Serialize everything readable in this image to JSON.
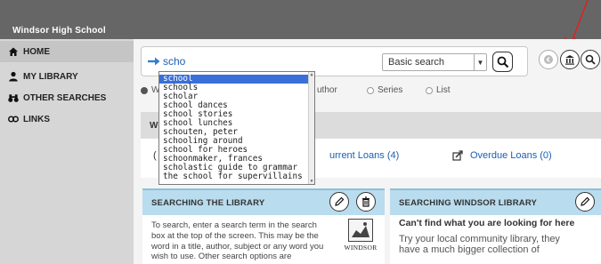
{
  "header": {
    "school_name": "Windsor High School"
  },
  "sidebar": {
    "items": [
      {
        "label": "HOME",
        "icon": "home-icon",
        "active": true
      },
      {
        "label": "MY LIBRARY",
        "icon": "person-icon",
        "active": false
      },
      {
        "label": "OTHER SEARCHES",
        "icon": "binoculars-icon",
        "active": false
      },
      {
        "label": "LINKS",
        "icon": "link-icon",
        "active": false
      }
    ]
  },
  "search": {
    "query": "scho",
    "type_selected": "Basic search",
    "radio_options": [
      {
        "label": "W",
        "selected": true
      },
      {
        "label": "uthor",
        "selected": false
      },
      {
        "label": "Series",
        "selected": false
      },
      {
        "label": "List",
        "selected": false
      }
    ]
  },
  "autocomplete": {
    "suggestions": [
      "school",
      "schools",
      "scholar",
      "school dances",
      "school stories",
      "school lunches",
      "schouten, peter",
      "schooling around",
      "school for heroes",
      "schoonmaker, frances",
      "scholastic guide to grammar",
      "the school for supervillains"
    ],
    "selected_index": 0
  },
  "tabs_band": {
    "partial_label": "W"
  },
  "loans": {
    "paren_partial": "(",
    "current_label": "urrent Loans  (4)",
    "overdue_label": "Overdue Loans  (0)"
  },
  "cards": {
    "searching_library": {
      "title": "SEARCHING THE LIBRARY",
      "body_lines": [
        "To search, enter a search term in the search",
        "box at the top of the screen.  This may be the",
        "word in a title, author, subject or any word you",
        "wish to use.  Other search options are"
      ],
      "logo_caption": "WINDSOR"
    },
    "searching_windsor": {
      "title": "SEARCHING WINDSOR LIBRARY",
      "lead": "Can't find what you are looking for here",
      "body_lines": [
        "Try your local community library, they",
        "have a much bigger collection of"
      ]
    }
  },
  "colors": {
    "topbar": "#666666",
    "sidebar": "#d6d6d6",
    "card_header": "#b9dcee",
    "link": "#1a5fb4",
    "annotation_arrow": "#e02020"
  }
}
